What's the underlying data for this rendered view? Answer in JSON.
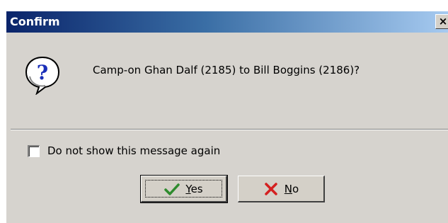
{
  "window": {
    "title": "Confirm",
    "close_glyph": "×"
  },
  "message": {
    "icon": "question-icon",
    "text": "Camp-on Ghan Dalf (2185) to Bill Boggins (2186)?"
  },
  "checkbox": {
    "label": "Do not show this message again",
    "checked": false
  },
  "buttons": {
    "yes": {
      "label_first": "Y",
      "label_rest": "es",
      "icon": "checkmark-icon",
      "icon_color": "#2e8b2e"
    },
    "no": {
      "label_first": "N",
      "label_rest": "o",
      "icon": "x-icon",
      "icon_color": "#d42020"
    }
  },
  "colors": {
    "dialog_bg": "#d6d3ce",
    "titlebar_start": "#0a246a",
    "titlebar_end": "#a6caf0"
  }
}
